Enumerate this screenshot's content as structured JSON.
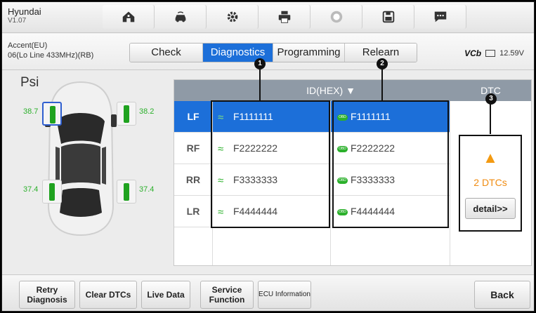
{
  "brand": {
    "title": "Hyundai",
    "version": "V1.07"
  },
  "toolbar_icons": [
    "home-icon",
    "vehicle-menu-icon",
    "settings-icon",
    "print-icon",
    "help-icon",
    "save-icon",
    "message-icon"
  ],
  "vehicle": {
    "model": "Accent(EU)",
    "variant": "06(Lo Line 433MHz)(RB)"
  },
  "tabs": [
    {
      "label": "Check",
      "active": false
    },
    {
      "label": "Diagnostics",
      "active": true
    },
    {
      "label": "Programming",
      "active": false
    },
    {
      "label": "Relearn",
      "active": false
    }
  ],
  "vcb": {
    "label": "VCb",
    "voltage": "12.59V"
  },
  "unit": "Psi",
  "pressures": {
    "lf": "38.7",
    "rf": "38.2",
    "lr": "37.4",
    "rr": "37.4"
  },
  "table": {
    "id_header": "ID(HEX) ▼",
    "dtc_header": "DTC",
    "rows": [
      {
        "pos": "LF",
        "id1": "F1111111",
        "id2": "F1111111"
      },
      {
        "pos": "RF",
        "id1": "F2222222",
        "id2": "F2222222"
      },
      {
        "pos": "RR",
        "id1": "F3333333",
        "id2": "F3333333"
      },
      {
        "pos": "LR",
        "id1": "F4444444",
        "id2": "F4444444"
      }
    ],
    "obd_tag": "OBD",
    "dtc_count": "2 DTCs",
    "detail_label": "detail>>"
  },
  "callouts": [
    "1",
    "2",
    "3"
  ],
  "bottom": {
    "retry": "Retry Diagnosis",
    "clear": "Clear DTCs",
    "live": "Live Data",
    "service": "Service Function",
    "ecu": "ECU Information",
    "back": "Back"
  },
  "colors": {
    "accent": "#1c6fd9",
    "ok": "#2bb02b",
    "warn": "#f39a12",
    "header": "#8f9aa6"
  }
}
